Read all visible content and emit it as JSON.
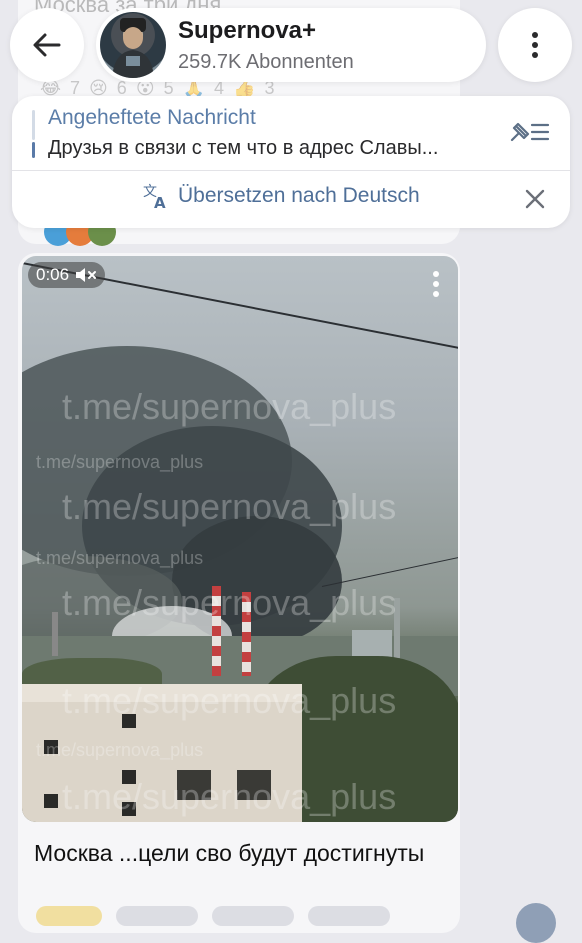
{
  "header": {
    "channel_title": "Supernova+",
    "subscribers": "259.7K Abonnenten",
    "back_icon": "arrow-left-icon",
    "menu_icon": "more-vertical-icon"
  },
  "background_message": {
    "text": "Москва за три дня....",
    "reactions": "😂 7   😢 6   😮 5   🙏 4   👍 3"
  },
  "pinned": {
    "title": "Angeheftete Nachricht",
    "text": "Друзья в связи с тем что в адрес Славы...",
    "icon": "unpin-list-icon"
  },
  "translate": {
    "label": "Übersetzen nach Deutsch",
    "icon": "translate-icon",
    "close_icon": "close-icon"
  },
  "video_message": {
    "duration": "0:06",
    "mute_icon": "speaker-muted-icon",
    "menu_icon": "more-vertical-icon",
    "watermark": "t.me/supernova_plus",
    "caption": "Москва ...цели сво будут достигнуты"
  },
  "colors": {
    "accent": "#5b7da8",
    "background": "#e9e9ee",
    "card": "#ffffff"
  }
}
